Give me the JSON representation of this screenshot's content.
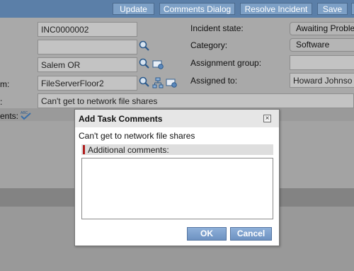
{
  "toolbar": {
    "update_label": "Update",
    "comments_dialog_label": "Comments Dialog",
    "resolve_incident_label": "Resolve Incident",
    "save_label": "Save"
  },
  "form": {
    "number_value": "INC0000002",
    "caller_value": "",
    "location_value": "Salem OR",
    "ci_label_partial": "m:",
    "ci_value": "FileServerFloor2",
    "short_desc_label_partial": ":",
    "short_desc_value": "Can't get to network file shares",
    "comments_label_partial": "ents:",
    "incident_state_label": "Incident state:",
    "incident_state_value": "Awaiting Proble",
    "category_label": "Category:",
    "category_value": "Software",
    "assignment_group_label": "Assignment group:",
    "assignment_group_value": "",
    "assigned_to_label": "Assigned to:",
    "assigned_to_value": "Howard Johnso"
  },
  "icons": {
    "search": "magnifier-icon",
    "preview": "reference-preview-icon",
    "spell": "spell-check-icon"
  },
  "dialog": {
    "title": "Add Task Comments",
    "message": "Can't get to network file shares",
    "section_label": "Additional comments:",
    "comment_value": "",
    "ok_label": "OK",
    "cancel_label": "Cancel"
  }
}
